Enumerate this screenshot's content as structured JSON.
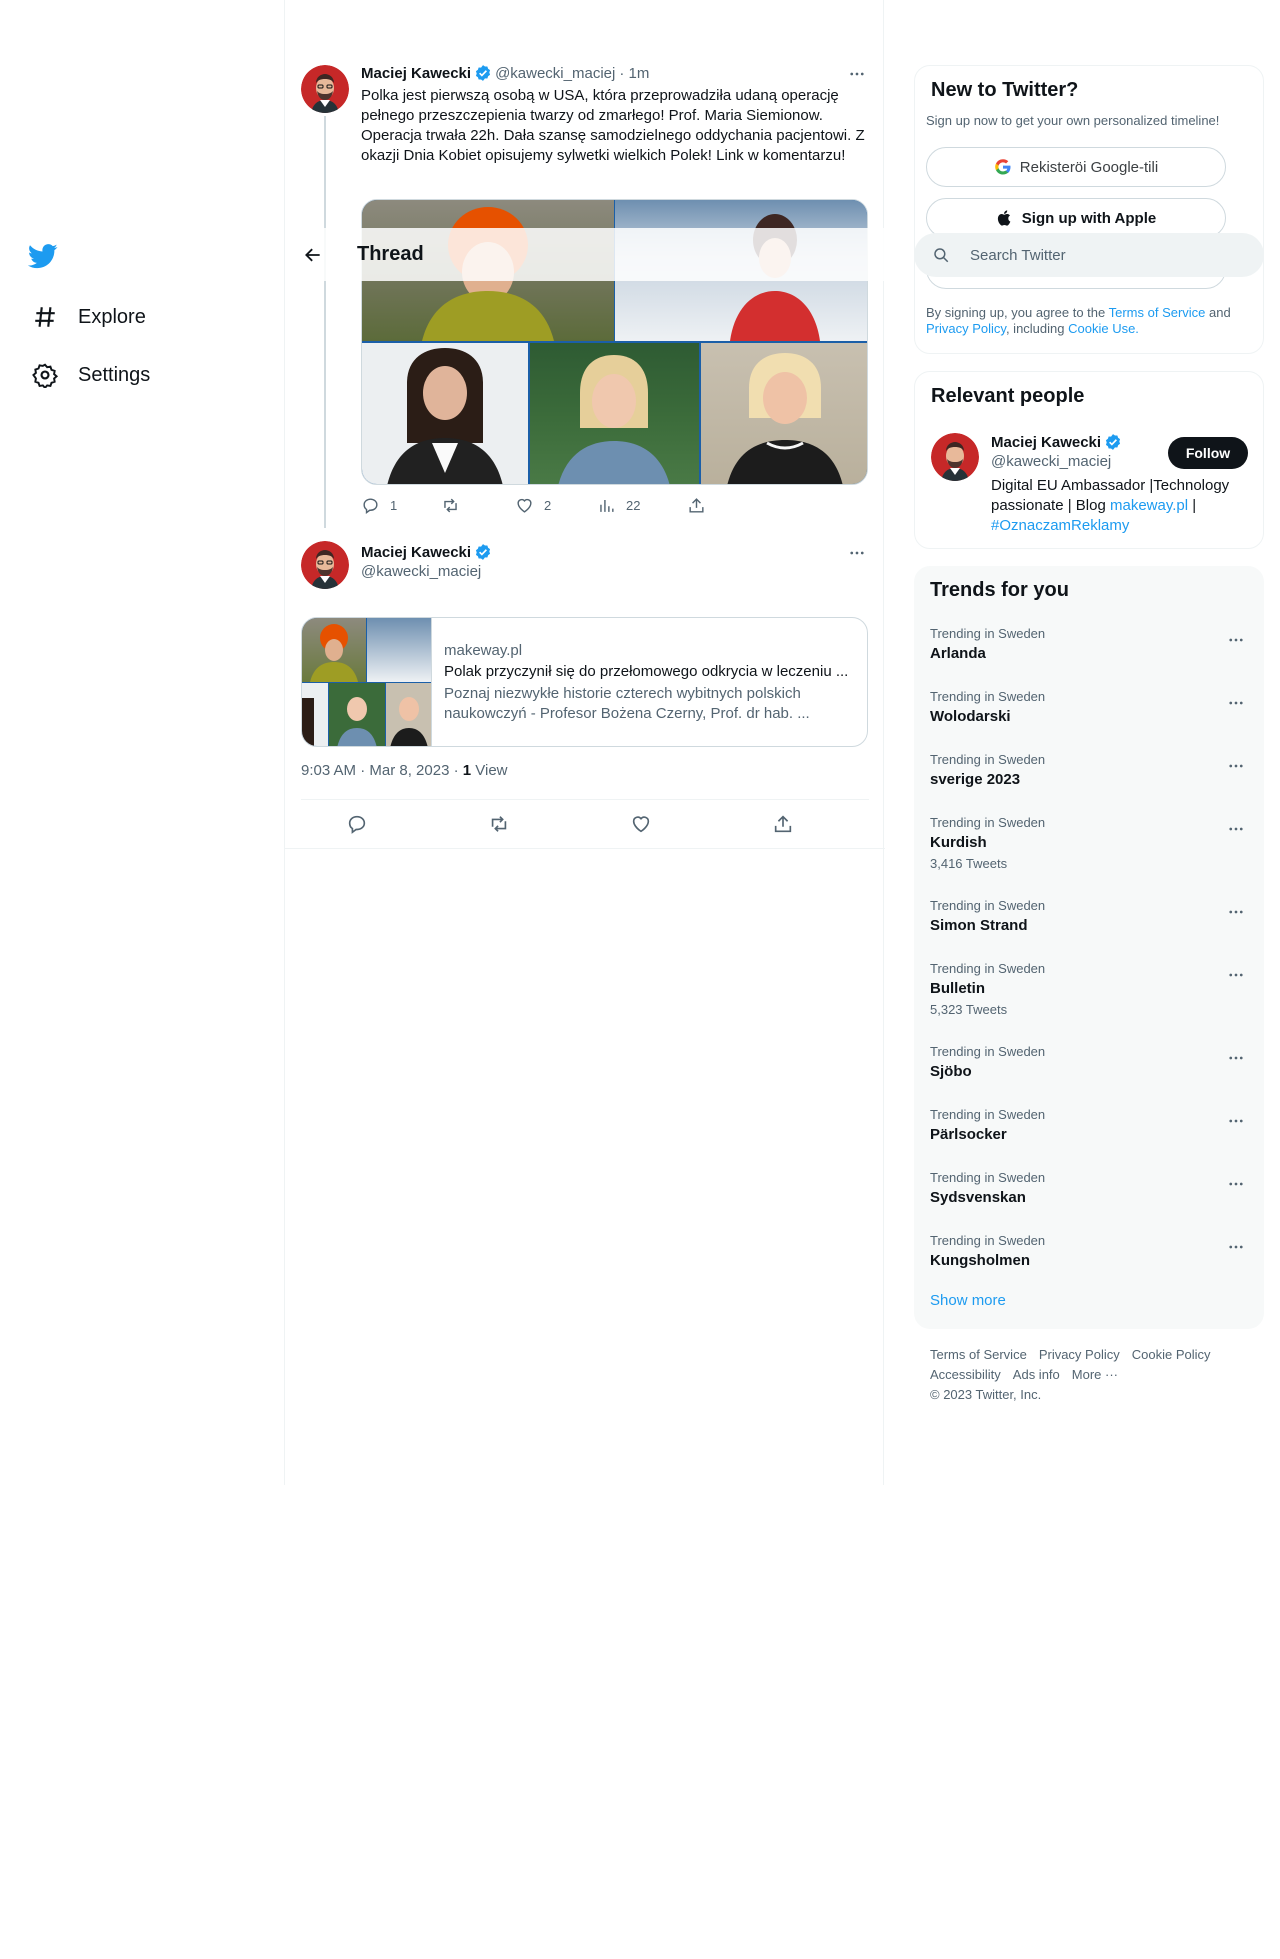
{
  "nav": {
    "explore_label": "Explore",
    "settings_label": "Settings"
  },
  "header": {
    "title": "Thread"
  },
  "tweet1": {
    "name": "Maciej Kawecki",
    "handle": "@kawecki_maciej",
    "time": "· 1m",
    "text": "Polka jest pierwszą osobą w USA, która przeprowadziła udaną operację pełnego przeszczepienia twarzy od zmarłego! Prof. Maria Siemionow. Operacja trwała 22h. Dała szansę samodzielnego oddychania pacjentowi. Z okazji Dnia Kobiet opisujemy sylwetki wielkich Polek! Link w komentarzu!",
    "replies": "1",
    "likes": "2",
    "views": "22"
  },
  "tweet2": {
    "name": "Maciej Kawecki",
    "handle": "@kawecki_maciej",
    "card": {
      "domain": "makeway.pl",
      "title": "Polak przyczynił się do przełomowego odkrycia w leczeniu ...",
      "description": "Poznaj niezwykłe historie czterech wybitnych polskich naukowczyń - Profesor Bożena Czerny, Prof. dr hab. ..."
    },
    "timestamp": "9:03 AM · Mar 8, 2023 · ",
    "views_count": "1",
    "views_label": " View"
  },
  "search": {
    "placeholder": "Search Twitter"
  },
  "new_to_twitter": {
    "title": "New to Twitter?",
    "subtitle": "Sign up now to get your own personalized timeline!",
    "google_label": "Rekisteröi Google-tili",
    "apple_label": "Sign up with Apple",
    "legal_prefix": "By signing up, you agree to the ",
    "terms_link": "Terms of Service",
    "legal_and": " and ",
    "privacy_link": "Privacy Policy",
    "legal_including": ", including ",
    "cookie_link": "Cookie Use."
  },
  "relevant_people": {
    "title": "Relevant people",
    "name": "Maciej Kawecki",
    "handle": "@kawecki_maciej",
    "follow_label": "Follow",
    "bio_prefix": "Digital EU Ambassador |Technology passionate | Blog ",
    "bio_link": "makeway.pl",
    "bio_sep": " | ",
    "bio_hashtag": "#OznaczamReklamy"
  },
  "trends": {
    "title": "Trends for you",
    "items": [
      {
        "context": "Trending in Sweden",
        "name": "Arlanda",
        "count": ""
      },
      {
        "context": "Trending in Sweden",
        "name": "Wolodarski",
        "count": ""
      },
      {
        "context": "Trending in Sweden",
        "name": "sverige 2023",
        "count": ""
      },
      {
        "context": "Trending in Sweden",
        "name": "Kurdish",
        "count": "3,416 Tweets"
      },
      {
        "context": "Trending in Sweden",
        "name": "Simon Strand",
        "count": ""
      },
      {
        "context": "Trending in Sweden",
        "name": "Bulletin",
        "count": "5,323 Tweets"
      },
      {
        "context": "Trending in Sweden",
        "name": "Sjöbo",
        "count": ""
      },
      {
        "context": "Trending in Sweden",
        "name": "Pärlsocker",
        "count": ""
      },
      {
        "context": "Trending in Sweden",
        "name": "Sydsvenskan",
        "count": ""
      },
      {
        "context": "Trending in Sweden",
        "name": "Kungsholmen",
        "count": ""
      }
    ],
    "show_more": "Show more"
  },
  "footer": {
    "terms": "Terms of Service",
    "privacy": "Privacy Policy",
    "cookie": "Cookie Policy",
    "accessibility": "Accessibility",
    "ads": "Ads info",
    "more": "More ···",
    "copyright": "© 2023 Twitter, Inc."
  },
  "colors": {
    "brand": "#1d9bf0",
    "text": "#0f1419",
    "secondary": "#536471",
    "border": "#eff3f4"
  }
}
